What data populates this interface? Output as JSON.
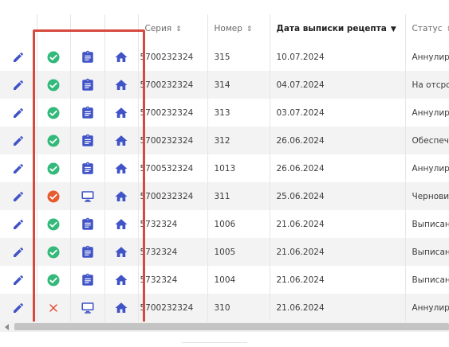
{
  "columns": {
    "series": "Серия",
    "number": "Номер",
    "date": "Дата выписки рецепта",
    "status": "Статус"
  },
  "icons": {
    "edit": "pencil-icon",
    "status_ok": "check-circle-icon",
    "status_warn": "alert-check-circle-icon",
    "status_error": "cross-icon",
    "doc_clipboard": "clipboard-icon",
    "doc_monitor": "monitor-icon",
    "home": "home-icon",
    "sort": "sort-icon",
    "sort_desc": "sort-desc-icon"
  },
  "colors": {
    "accent": "#4053c7",
    "ok": "#33b97a",
    "warn": "#e85b2e",
    "error": "#e0442f",
    "highlight": "#d6493d"
  },
  "rows": [
    {
      "status_icon": "ok",
      "doc_icon": "clipboard",
      "series": "5700232324",
      "number": "315",
      "date": "10.07.2024",
      "state": "Аннулиро"
    },
    {
      "status_icon": "ok",
      "doc_icon": "clipboard",
      "series": "5700232324",
      "number": "314",
      "date": "04.07.2024",
      "state": "На отсроч"
    },
    {
      "status_icon": "ok",
      "doc_icon": "clipboard",
      "series": "5700232324",
      "number": "313",
      "date": "03.07.2024",
      "state": "Аннулиро"
    },
    {
      "status_icon": "ok",
      "doc_icon": "clipboard",
      "series": "5700232324",
      "number": "312",
      "date": "26.06.2024",
      "state": "Обеспече"
    },
    {
      "status_icon": "ok",
      "doc_icon": "clipboard",
      "series": "5700532324",
      "number": "1013",
      "date": "26.06.2024",
      "state": "Аннулиро"
    },
    {
      "status_icon": "warn",
      "doc_icon": "monitor",
      "series": "5700232324",
      "number": "311",
      "date": "25.06.2024",
      "state": "Черновик"
    },
    {
      "status_icon": "ok",
      "doc_icon": "clipboard",
      "series": "5732324",
      "number": "1006",
      "date": "21.06.2024",
      "state": "Выписан"
    },
    {
      "status_icon": "ok",
      "doc_icon": "clipboard",
      "series": "5732324",
      "number": "1005",
      "date": "21.06.2024",
      "state": "Выписан"
    },
    {
      "status_icon": "ok",
      "doc_icon": "clipboard",
      "series": "5732324",
      "number": "1004",
      "date": "21.06.2024",
      "state": "Выписан"
    },
    {
      "status_icon": "error",
      "doc_icon": "monitor",
      "series": "5700232324",
      "number": "310",
      "date": "21.06.2024",
      "state": "Аннулиро"
    }
  ]
}
